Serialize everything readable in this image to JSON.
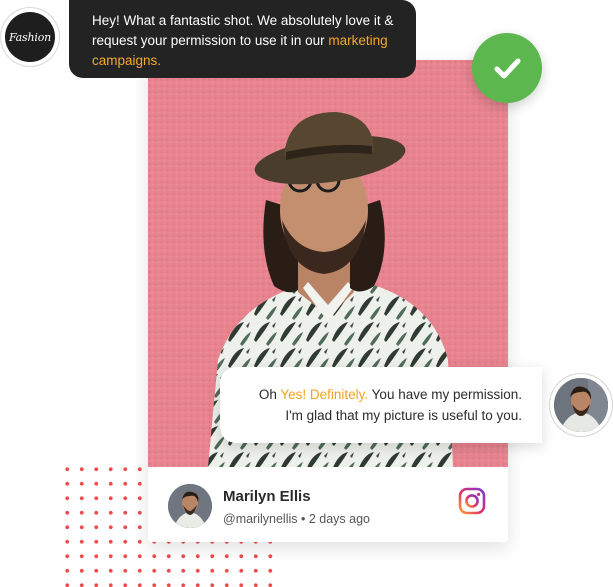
{
  "brand": {
    "logo_text": "Fashion"
  },
  "request_message": {
    "text_before": "Hey! What a fantastic shot. We absolutely love it & request your permission to use it in our",
    "highlight": "marketing campaigns."
  },
  "reply_message": {
    "prefix": "Oh",
    "highlight": "Yes! Definitely.",
    "text_after": "You have my permission.",
    "line2": "I'm glad that my picture is useful to you."
  },
  "post": {
    "author_name": "Marilyn Ellis",
    "author_meta": "@marilynellis • 2 days ago"
  },
  "colors": {
    "accent_orange": "#f7a928",
    "approve_green": "#5cb84e",
    "dots_red": "#ef4a4a",
    "photo_wall": "#e7848f",
    "bubble_dark": "#232323"
  },
  "icons": {
    "approve": "checkmark-icon",
    "social": "instagram-icon"
  }
}
